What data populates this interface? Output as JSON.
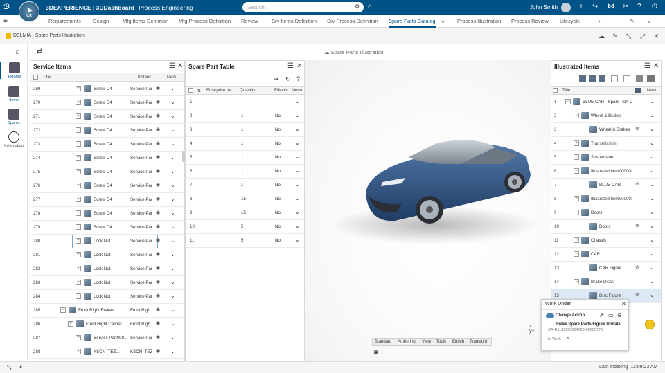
{
  "topbar": {
    "brand_3dx": "3DEXPERIENCE",
    "brand_sep": " | ",
    "brand_app": "3DDashboard",
    "brand_space": "Process Engineering",
    "compass_label": "V,R",
    "search_placeholder": "Search",
    "user_name": "John Smith"
  },
  "tabs": [
    "Requirements",
    "Design",
    "Mfg Items Definition",
    "Mfg Process Definition",
    "Review",
    "Srv Items Definition",
    "Srv Process Definition",
    "Spare Parts Catalog",
    "Process Illustration",
    "Process Review",
    "Lifecycle"
  ],
  "active_tab": "Spare Parts Catalog",
  "subbar": {
    "title": "DELMIA - Spare Parts Illustration"
  },
  "leftbar": {
    "items": [
      "Figures",
      "Items",
      "Spares",
      "Information"
    ]
  },
  "viewer": {
    "title": "Spare Parts Illustration",
    "tabs": [
      "Standard",
      "Authoring",
      "View",
      "Tools",
      "Enrich",
      "Transform"
    ]
  },
  "service_items": {
    "title": "Service Items",
    "headers": {
      "title": "Title",
      "instance": "Instanc",
      "menu": "Menu"
    },
    "rows": [
      {
        "n": "269",
        "title": "Screw D4",
        "inst": "Service Par"
      },
      {
        "n": "270",
        "title": "Screw D4",
        "inst": "Service Par"
      },
      {
        "n": "271",
        "title": "Screw D4",
        "inst": "Service Par"
      },
      {
        "n": "272",
        "title": "Screw D4",
        "inst": "Service Par"
      },
      {
        "n": "273",
        "title": "Screw D4",
        "inst": "Service Par"
      },
      {
        "n": "274",
        "title": "Screw D4",
        "inst": "Service Par"
      },
      {
        "n": "275",
        "title": "Screw D4",
        "inst": "Service Par"
      },
      {
        "n": "276",
        "title": "Screw D4",
        "inst": "Service Par"
      },
      {
        "n": "277",
        "title": "Screw D4",
        "inst": "Service Par"
      },
      {
        "n": "278",
        "title": "Screw D4",
        "inst": "Service Par"
      },
      {
        "n": "279",
        "title": "Screw D4",
        "inst": "Service Par"
      },
      {
        "n": "280",
        "title": "Lock Nut",
        "inst": "Service Par"
      },
      {
        "n": "281",
        "title": "Lock Nut",
        "inst": "Service Par"
      },
      {
        "n": "282",
        "title": "Lock Nut",
        "inst": "Service Par"
      },
      {
        "n": "283",
        "title": "Lock Nut",
        "inst": "Service Par"
      },
      {
        "n": "284",
        "title": "Lock Nut",
        "inst": "Service Par"
      },
      {
        "n": "285",
        "title": "Front Right Brakes",
        "inst": "Front Righ"
      },
      {
        "n": "286",
        "title": "Front Right Caliper",
        "inst": "Front Righ"
      },
      {
        "n": "287",
        "title": "Service Part000...",
        "inst": "Service Par"
      },
      {
        "n": "288",
        "title": "KSCN_TEZ...",
        "inst": "KSCN_TEZ"
      }
    ]
  },
  "spare_table": {
    "title": "Spare Part Table",
    "headers": {
      "enterprise": "Enterprise Ite...",
      "quantity": "Quantity",
      "effective": "Effectiv",
      "menu": "Menu"
    },
    "rows": [
      {
        "n": "1",
        "qty": "",
        "eff": ""
      },
      {
        "n": "2",
        "qty": "1",
        "eff": "No"
      },
      {
        "n": "3",
        "qty": "1",
        "eff": "No"
      },
      {
        "n": "4",
        "qty": "1",
        "eff": "No"
      },
      {
        "n": "5",
        "qty": "1",
        "eff": "No"
      },
      {
        "n": "6",
        "qty": "1",
        "eff": "No"
      },
      {
        "n": "7",
        "qty": "1",
        "eff": "No"
      },
      {
        "n": "8",
        "qty": "15",
        "eff": "No"
      },
      {
        "n": "9",
        "qty": "15",
        "eff": "No"
      },
      {
        "n": "10",
        "qty": "5",
        "eff": "No"
      },
      {
        "n": "11",
        "qty": "5",
        "eff": "No"
      }
    ]
  },
  "illustrated_items": {
    "title": "Illustrated Items",
    "headers": {
      "title": "Title",
      "menu": "Menu"
    },
    "rows": [
      {
        "n": "1",
        "title": "BLUE CAR - Spare Part Ca",
        "lvl": 0
      },
      {
        "n": "2",
        "title": "Wheel & Brakes",
        "lvl": 1
      },
      {
        "n": "3",
        "title": "Wheel & Brakes",
        "lvl": 2
      },
      {
        "n": "4",
        "title": "Transmission",
        "lvl": 1
      },
      {
        "n": "5",
        "title": "Suspension",
        "lvl": 1
      },
      {
        "n": "6",
        "title": "Illustrated Item000002",
        "lvl": 1
      },
      {
        "n": "7",
        "title": "BLUE CAR",
        "lvl": 2
      },
      {
        "n": "8",
        "title": "Illustrated Item000001",
        "lvl": 1
      },
      {
        "n": "9",
        "title": "Doors",
        "lvl": 1
      },
      {
        "n": "10",
        "title": "Doors",
        "lvl": 2
      },
      {
        "n": "11",
        "title": "Chassis",
        "lvl": 1
      },
      {
        "n": "12",
        "title": "CAR",
        "lvl": 1
      },
      {
        "n": "13",
        "title": "CAR Figure",
        "lvl": 2
      },
      {
        "n": "14",
        "title": "Brake Discs",
        "lvl": 1
      },
      {
        "n": "15",
        "title": "Disc Figure",
        "lvl": 2
      }
    ]
  },
  "work_under": {
    "title": "Work Under",
    "change_action": "Change Action",
    "ca_title": "Brake Spare Parts Figure Update",
    "ca_id": "CA-R1132100004729-00000775",
    "state": "In Work"
  },
  "status": {
    "text": "Last Indexing :11:09:23 AM"
  },
  "colors": {
    "brand": "#005386",
    "accent": "#4a7fb5"
  }
}
